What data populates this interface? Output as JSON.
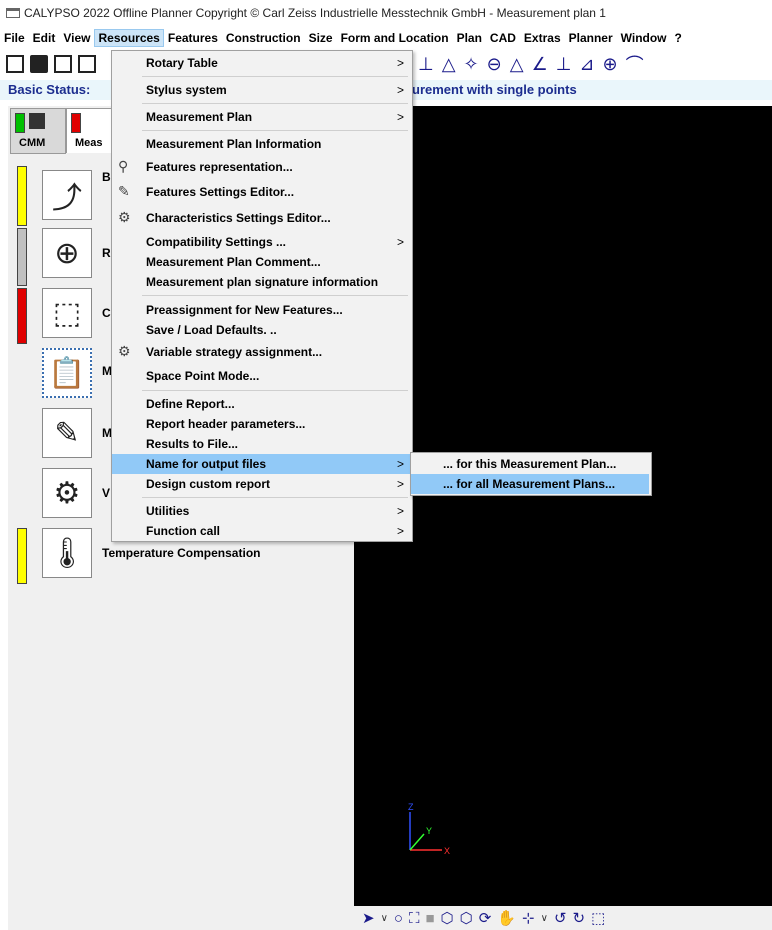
{
  "window": {
    "title": "CALYPSO 2022 Offline Planner Copyright © Carl Zeiss Industrielle Messtechnik GmbH - Measurement plan 1"
  },
  "menubar": {
    "items": [
      "File",
      "Edit",
      "View",
      "Resources",
      "Features",
      "Construction",
      "Size",
      "Form and Location",
      "Plan",
      "CAD",
      "Extras",
      "Planner",
      "Window",
      "?"
    ],
    "active": "Resources"
  },
  "status": {
    "label": "Basic Status:",
    "value": "urement with single points"
  },
  "left_panel": {
    "tabs": [
      {
        "label": "CMM",
        "indicator_color": "#00c000"
      },
      {
        "label": "Meas",
        "indicator_color": "#e00000"
      }
    ],
    "rows": [
      {
        "letter": "B",
        "icon": "base-alignment-icon",
        "color": "#ffff00"
      },
      {
        "letter": "R",
        "icon": "rotary-alignment-icon",
        "color": "#c0c0c0"
      },
      {
        "letter": "C",
        "icon": "clearance-data-icon",
        "color": "#e00000"
      },
      {
        "letter": "M",
        "icon": "measurement-plan-icon",
        "color": ""
      },
      {
        "letter": "M",
        "icon": "features-edit-icon",
        "color": ""
      },
      {
        "letter": "V",
        "icon": "variable-strategy-icon",
        "color": ""
      },
      {
        "letter": "Temperature Compensation",
        "icon": "temperature-icon",
        "color": "#ffff00"
      }
    ]
  },
  "resources_menu": {
    "items": [
      {
        "label": "Rotary Table",
        "submenu": true
      },
      {
        "label": "Stylus system",
        "submenu": true
      },
      {
        "label": "Measurement Plan",
        "submenu": true
      },
      {
        "label": "Measurement Plan Information",
        "submenu": false
      },
      {
        "label": "Features representation...",
        "submenu": false
      },
      {
        "label": "Features Settings Editor...",
        "submenu": false
      },
      {
        "label": "Characteristics Settings Editor...",
        "submenu": false
      },
      {
        "label": "Compatibility Settings ...",
        "submenu": true
      },
      {
        "label": "Measurement Plan Comment...",
        "submenu": false
      },
      {
        "label": "Measurement plan signature information",
        "submenu": false
      },
      {
        "label": "Preassignment for New Features...",
        "submenu": false
      },
      {
        "label": "Save / Load Defaults. ..",
        "submenu": false
      },
      {
        "label": "Variable strategy assignment...",
        "submenu": false
      },
      {
        "label": "Space Point Mode...",
        "submenu": false
      },
      {
        "label": "Define Report...",
        "submenu": false
      },
      {
        "label": "Report header parameters...",
        "submenu": false
      },
      {
        "label": "Results to File...",
        "submenu": false
      },
      {
        "label": "Name for output files",
        "submenu": true
      },
      {
        "label": "Design custom report",
        "submenu": true
      },
      {
        "label": "Utilities",
        "submenu": true
      },
      {
        "label": "Function call",
        "submenu": true
      }
    ],
    "highlighted": "Name for output files"
  },
  "output_files_submenu": {
    "items": [
      "... for this Measurement Plan...",
      "... for all Measurement Plans..."
    ],
    "highlighted": "... for all Measurement Plans..."
  },
  "axes": {
    "x": "X",
    "y": "Y",
    "z": "Z"
  }
}
